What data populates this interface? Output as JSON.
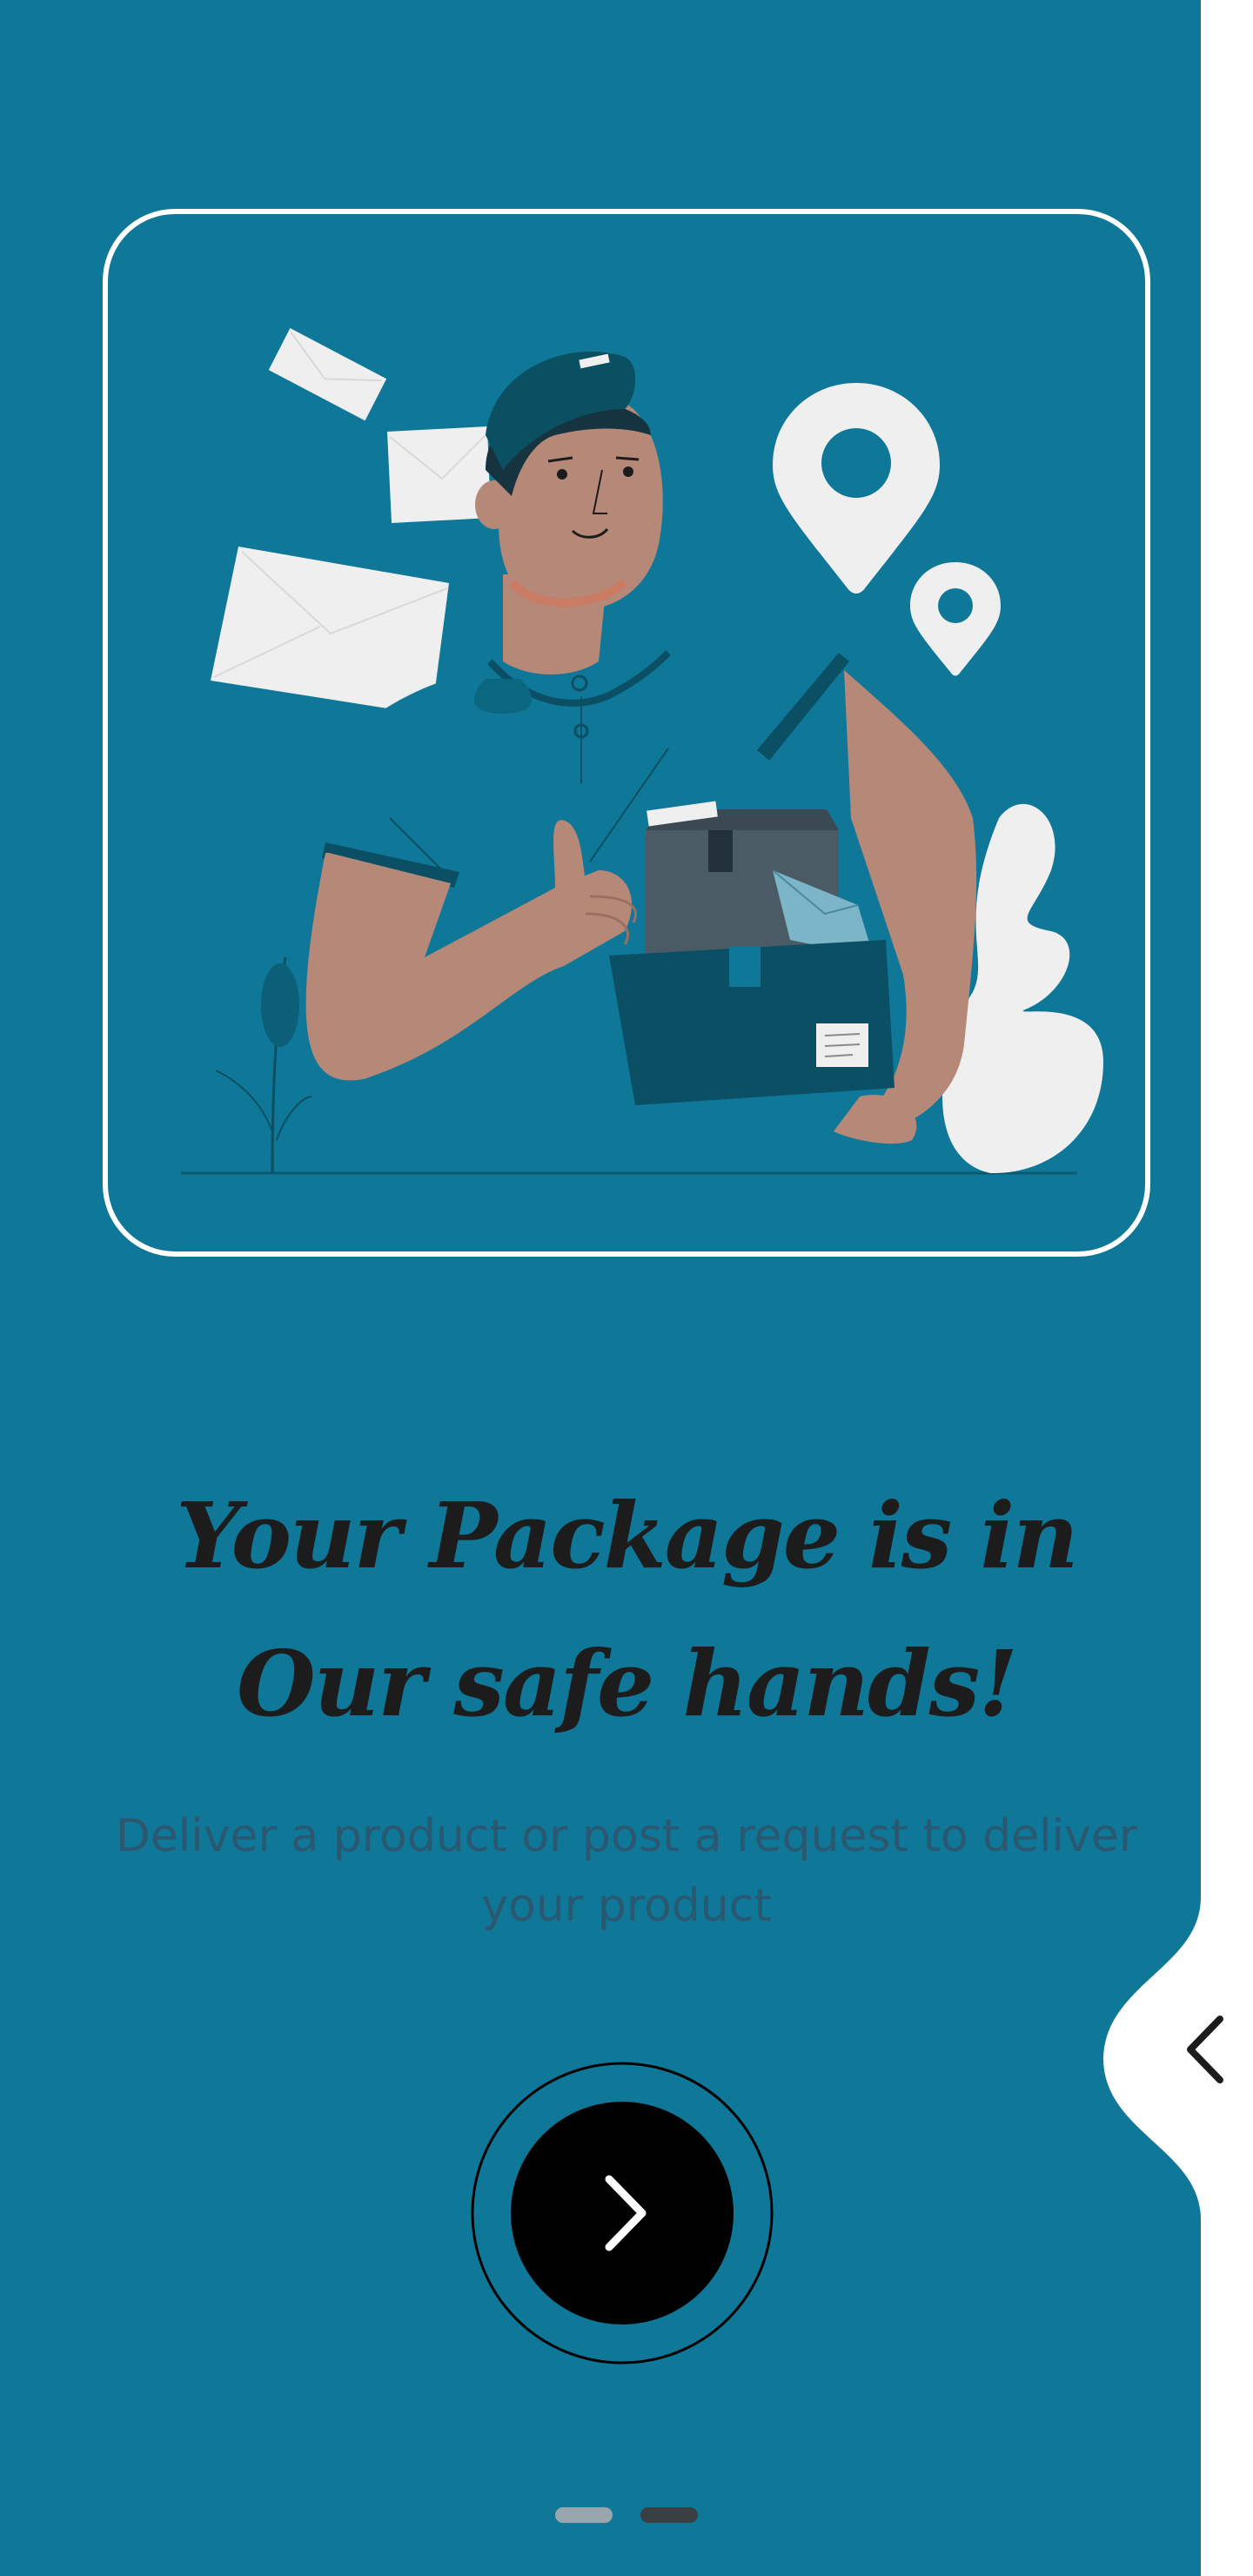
{
  "onboarding": {
    "title": "Your Package is in Our safe hands!",
    "subtitle": "Deliver a product or post a request to deliver your product",
    "next_button": {
      "icon": "chevron-right-icon",
      "label": "Next"
    },
    "back_tab": {
      "icon": "chevron-left-icon",
      "label": "Back"
    },
    "pagination": {
      "total": 2,
      "current": 2
    }
  },
  "illustration": {
    "subject": "courier holding packages with thumbs up",
    "elements": [
      "envelope-icon",
      "location-pin-icon",
      "package-box",
      "plant-leaf"
    ]
  },
  "colors": {
    "background": "#0f7798",
    "panel_white": "#ffffff",
    "headline": "#1c1c1c",
    "subtext": "#2a5870",
    "button": "#000000",
    "dot_inactive": "#9aa6ad",
    "dot_active": "#3a3f44"
  }
}
